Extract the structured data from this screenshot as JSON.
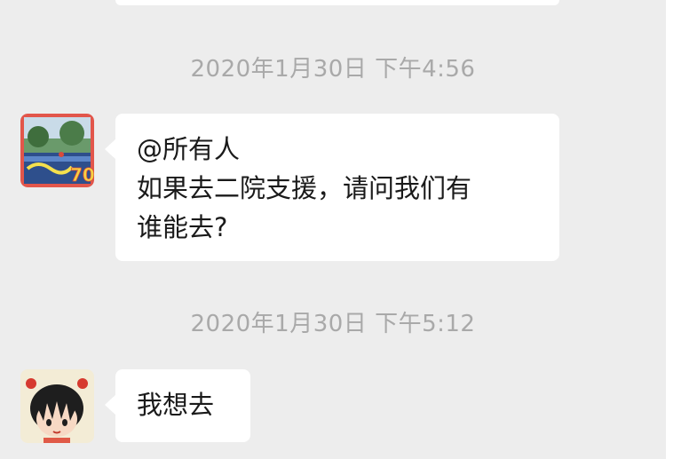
{
  "messages": [
    {
      "timestamp": "2020年1月30日 下午4:56",
      "line1": "@所有人",
      "line2": "如果去二院支援，请问我们有",
      "line3": "谁能去?"
    },
    {
      "timestamp": "2020年1月30日 下午5:12",
      "text": "我想去"
    }
  ],
  "colors": {
    "chat_background": "#ededed",
    "bubble": "#ffffff",
    "timestamp": "#a9a9a9",
    "avatar_border": "#e2564b"
  },
  "avatar1": {
    "badge": "70"
  }
}
